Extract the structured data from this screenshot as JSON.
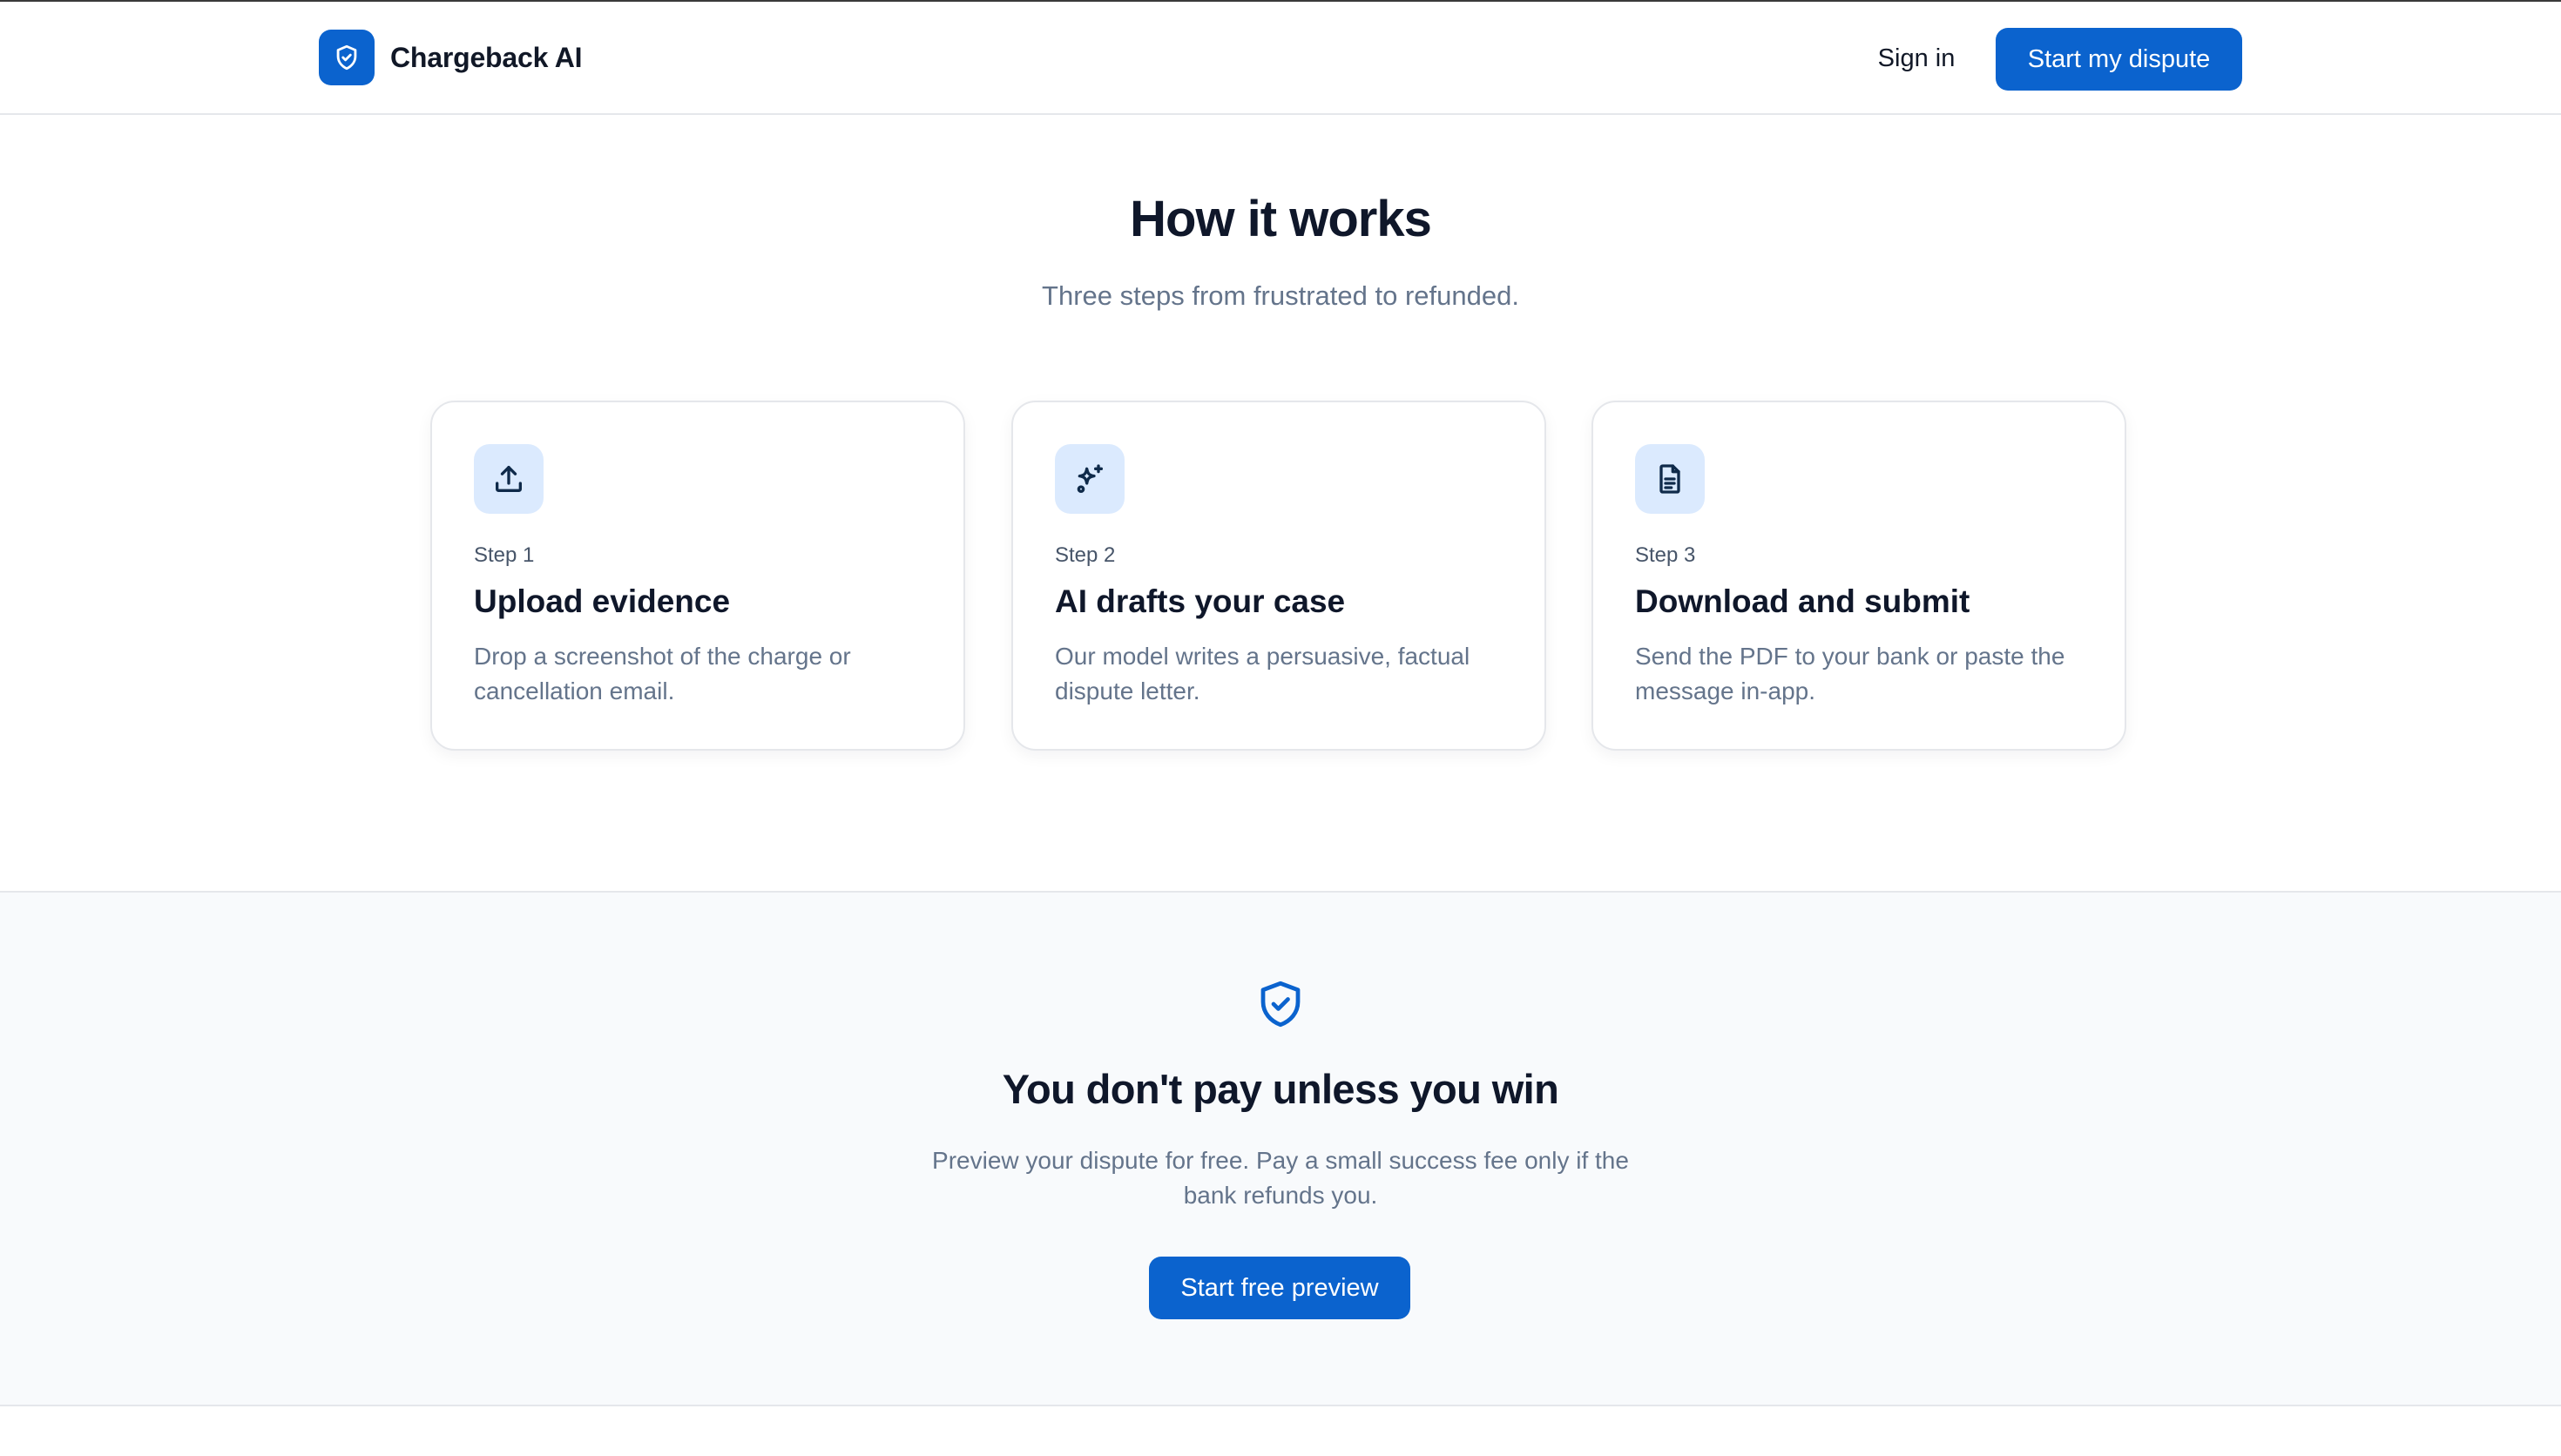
{
  "header": {
    "brand_name": "Chargeback AI",
    "brand_icon": "shield-check-icon",
    "sign_in": "Sign in",
    "cta": "Start my dispute"
  },
  "how_it_works": {
    "title": "How it works",
    "subtitle": "Three steps from frustrated to refunded.",
    "steps": [
      {
        "icon": "upload-icon",
        "step": "Step 1",
        "title": "Upload evidence",
        "description": "Drop a screenshot of the charge or cancellation email."
      },
      {
        "icon": "sparkles-icon",
        "step": "Step 2",
        "title": "AI drafts your case",
        "description": "Our model writes a persuasive, factual dispute letter."
      },
      {
        "icon": "document-icon",
        "step": "Step 3",
        "title": "Download and submit",
        "description": "Send the PDF to your bank or paste the message in-app."
      }
    ]
  },
  "guarantee": {
    "icon": "shield-check-icon",
    "title": "You don't pay unless you win",
    "description": "Preview your dispute for free. Pay a small success fee only if the bank refunds you.",
    "cta": "Start free preview"
  },
  "colors": {
    "primary": "#0b63ce",
    "icon_bg": "#dbeafe",
    "section_bg": "#f8fafc",
    "muted_text": "#64748b"
  }
}
